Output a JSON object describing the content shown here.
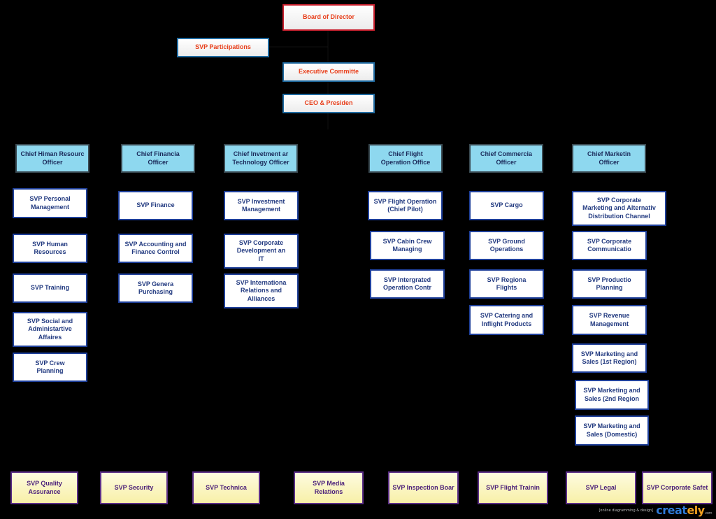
{
  "top": {
    "board": "Board of Director",
    "participations": "SVP Participations",
    "executive": "Executive Committe",
    "ceo": "CEO & Presiden"
  },
  "columns": [
    {
      "chief": "Chief Himan Resourc\nOfficer",
      "svps": [
        "SVP Personal\nManagement",
        "SVP Human\nResources",
        "SVP Training",
        "SVP Social and\nAdministartive\nAffaires",
        "SVP Crew\nPlanning"
      ]
    },
    {
      "chief": "Chief Financia\nOfficer",
      "svps": [
        "SVP Finance",
        "SVP Accounting and\nFinance Control",
        "SVP Genera\nPurchasing"
      ]
    },
    {
      "chief": "Chief Invetment ar\nTechnology Officer",
      "svps": [
        "SVP Investment\nManagement",
        "SVP Corporate\nDevelopment an\nIT",
        "SVP Internationa\nRelations and\nAlliances"
      ]
    },
    {
      "chief": "Chief Flight\nOperation Office",
      "svps": [
        "SVP Flight Operation\n(Chief Pilot)",
        "SVP Cabin Crew\nManaging",
        "SVP Intergrated\nOperation Contr"
      ]
    },
    {
      "chief": "Chief Commercia\nOfficer",
      "svps": [
        "SVP Cargo",
        "SVP Ground\nOperations",
        "SVP Regiona\nFlights",
        "SVP Catering and\nInflight Products"
      ]
    },
    {
      "chief": "Chief Marketin\nOfficer",
      "svps": [
        "SVP Corporate\nMarketing and Alternativ\nDistribution Channel",
        "SVP Corporate\nCommunicatio",
        "SVP Productio\nPlanning",
        "SVP Revenue\nManagement",
        "SVP Marketing and\nSales (1st Region)",
        "SVP Marketing and\nSales (2nd Region",
        "SVP Marketing and\nSales (Domestic)"
      ]
    }
  ],
  "staff": [
    "SVP Quality\nAssurance",
    "SVP Security",
    "SVP Technica",
    "SVP Media Relations",
    "SVP Inspection Boar",
    "SVP Flight Trainin",
    "SVP Legal",
    "SVP Corporate Safet"
  ],
  "footer": {
    "tagline": "[online diagramming & design]",
    "logo_main": "creat",
    "logo_accent": "ely",
    "logo_suffix": ".com"
  }
}
